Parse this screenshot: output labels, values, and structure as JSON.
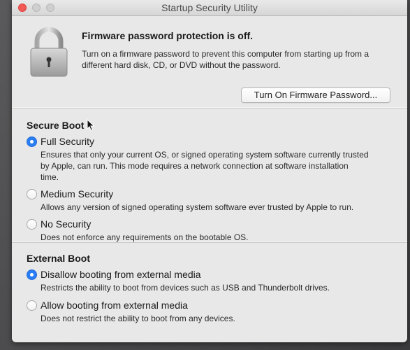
{
  "window": {
    "title": "Startup Security Utility"
  },
  "firmware": {
    "heading": "Firmware password protection is off.",
    "description": "Turn on a firmware password to prevent this computer from starting up from a different hard disk, CD, or DVD without the password.",
    "button_label": "Turn On Firmware Password..."
  },
  "secure_boot": {
    "title": "Secure Boot",
    "options": [
      {
        "label": "Full Security",
        "selected": true,
        "description": "Ensures that only your current OS, or signed operating system software currently trusted by Apple, can run. This mode requires a network connection at software installation time."
      },
      {
        "label": "Medium Security",
        "selected": false,
        "description": "Allows any version of signed operating system software ever trusted by Apple to run."
      },
      {
        "label": "No Security",
        "selected": false,
        "description": "Does not enforce any requirements on the bootable OS."
      }
    ]
  },
  "external_boot": {
    "title": "External Boot",
    "options": [
      {
        "label": "Disallow booting from external media",
        "selected": true,
        "description": "Restricts the ability to boot from devices such as USB and Thunderbolt drives."
      },
      {
        "label": "Allow booting from external media",
        "selected": false,
        "description": "Does not restrict the ability to boot from any devices."
      }
    ]
  },
  "colors": {
    "accent": "#2a7ef5",
    "window_bg": "#e8e8e8"
  }
}
